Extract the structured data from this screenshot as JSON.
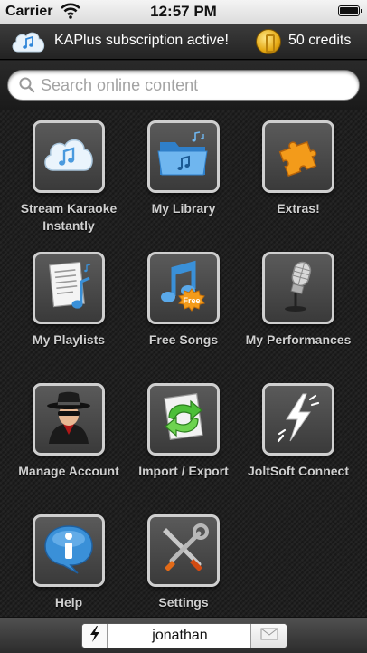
{
  "status_bar": {
    "carrier": "Carrier",
    "time": "12:57 PM"
  },
  "subscription": {
    "status_text": "KAPlus subscription active!",
    "credits_text": "50 credits"
  },
  "search": {
    "placeholder": "Search online content",
    "value": ""
  },
  "menu": {
    "items": [
      {
        "label": "Stream Karaoke Instantly",
        "icon": "cloud-music-icon"
      },
      {
        "label": "My Library",
        "icon": "music-folder-icon"
      },
      {
        "label": "Extras!",
        "icon": "puzzle-icon"
      },
      {
        "label": "My Playlists",
        "icon": "playlist-icon"
      },
      {
        "label": "Free Songs",
        "icon": "free-note-icon"
      },
      {
        "label": "My Performances",
        "icon": "microphone-icon"
      },
      {
        "label": "Manage Account",
        "icon": "spy-icon"
      },
      {
        "label": "Import / Export",
        "icon": "import-export-icon"
      },
      {
        "label": "JoltSoft Connect",
        "icon": "lightning-icon"
      },
      {
        "label": "Help",
        "icon": "info-bubble-icon"
      },
      {
        "label": "Settings",
        "icon": "tools-icon"
      }
    ]
  },
  "bottom_bar": {
    "username": "jonathan"
  },
  "colors": {
    "accent_blue": "#2f86d8",
    "tile_border": "#cfcfcf",
    "label_text": "#cfcfcf",
    "background": "#202020"
  }
}
